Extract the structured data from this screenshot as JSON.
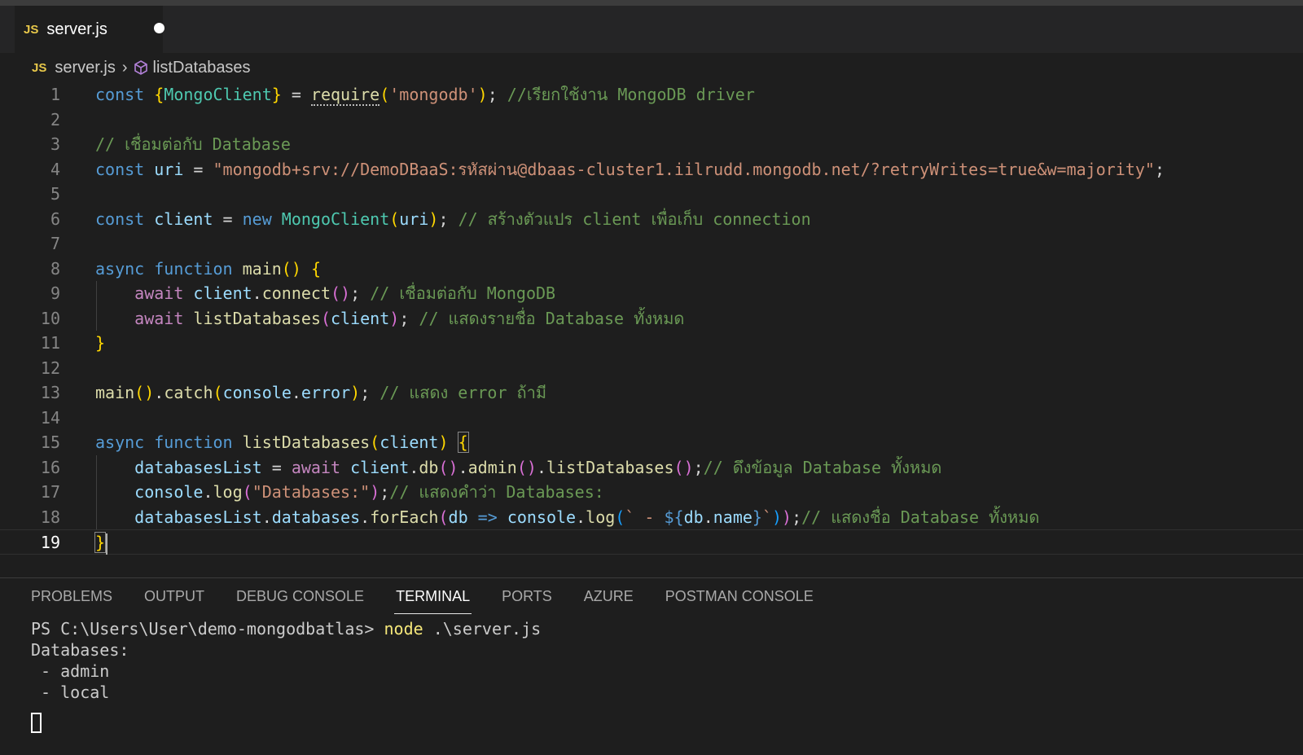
{
  "tab": {
    "icon": "JS",
    "filename": "server.js",
    "dirty": true
  },
  "breadcrumb": {
    "file_icon": "JS",
    "file": "server.js",
    "symbol_icon": "cube-icon",
    "symbol": "listDatabases"
  },
  "editor": {
    "current_line": 19,
    "line_numbers": [
      "1",
      "2",
      "3",
      "4",
      "5",
      "6",
      "7",
      "8",
      "9",
      "10",
      "11",
      "12",
      "13",
      "14",
      "15",
      "16",
      "17",
      "18",
      "19"
    ],
    "lines": [
      [
        [
          "kw",
          "const "
        ],
        [
          "br1",
          "{"
        ],
        [
          "cls",
          "MongoClient"
        ],
        [
          "br1",
          "}"
        ],
        [
          "pun",
          " = "
        ],
        [
          "fn",
          "require"
        ],
        [
          "br1",
          "("
        ],
        [
          "str",
          "'mongodb'"
        ],
        [
          "br1",
          ")"
        ],
        [
          "pun",
          "; "
        ],
        [
          "cmt",
          "//เรียกใช้งาน MongoDB driver"
        ]
      ],
      [],
      [
        [
          "cmt",
          "// เชื่อมต่อกับ Database"
        ]
      ],
      [
        [
          "kw",
          "const "
        ],
        [
          "var",
          "uri"
        ],
        [
          "pun",
          " = "
        ],
        [
          "str",
          "\"mongodb+srv://DemoDBaaS:รหัสผ่าน@dbaas-cluster1.iilrudd.mongodb.net/?retryWrites=true&w=majority\""
        ],
        [
          "pun",
          ";"
        ]
      ],
      [],
      [
        [
          "kw",
          "const "
        ],
        [
          "var",
          "client"
        ],
        [
          "pun",
          " = "
        ],
        [
          "kw",
          "new "
        ],
        [
          "cls",
          "MongoClient"
        ],
        [
          "br1",
          "("
        ],
        [
          "var",
          "uri"
        ],
        [
          "br1",
          ")"
        ],
        [
          "pun",
          "; "
        ],
        [
          "cmt",
          "// สร้างตัวแปร client เพื่อเก็บ connection"
        ]
      ],
      [],
      [
        [
          "kw",
          "async "
        ],
        [
          "kw",
          "function "
        ],
        [
          "fn",
          "main"
        ],
        [
          "br1",
          "()"
        ],
        [
          "pun",
          " "
        ],
        [
          "br1",
          "{"
        ]
      ],
      [
        [
          "pun",
          "    "
        ],
        [
          "ctl",
          "await "
        ],
        [
          "var",
          "client"
        ],
        [
          "pun",
          "."
        ],
        [
          "fn",
          "connect"
        ],
        [
          "br2",
          "()"
        ],
        [
          "pun",
          "; "
        ],
        [
          "cmt",
          "// เชื่อมต่อกับ MongoDB"
        ]
      ],
      [
        [
          "pun",
          "    "
        ],
        [
          "ctl",
          "await "
        ],
        [
          "fn",
          "listDatabases"
        ],
        [
          "br2",
          "("
        ],
        [
          "var",
          "client"
        ],
        [
          "br2",
          ")"
        ],
        [
          "pun",
          "; "
        ],
        [
          "cmt",
          "// แสดงรายชื่อ Database ทั้งหมด"
        ]
      ],
      [
        [
          "br1",
          "}"
        ]
      ],
      [],
      [
        [
          "fn",
          "main"
        ],
        [
          "br1",
          "()"
        ],
        [
          "pun",
          "."
        ],
        [
          "fn",
          "catch"
        ],
        [
          "br1",
          "("
        ],
        [
          "var",
          "console"
        ],
        [
          "pun",
          "."
        ],
        [
          "var",
          "error"
        ],
        [
          "br1",
          ")"
        ],
        [
          "pun",
          "; "
        ],
        [
          "cmt",
          "// แสดง error ถ้ามี"
        ]
      ],
      [],
      [
        [
          "kw",
          "async "
        ],
        [
          "kw",
          "function "
        ],
        [
          "fn",
          "listDatabases"
        ],
        [
          "br1",
          "("
        ],
        [
          "var",
          "client"
        ],
        [
          "br1",
          ")"
        ],
        [
          "pun",
          " "
        ],
        [
          "br1",
          "{"
        ]
      ],
      [
        [
          "pun",
          "    "
        ],
        [
          "var",
          "databasesList"
        ],
        [
          "pun",
          " = "
        ],
        [
          "ctl",
          "await "
        ],
        [
          "var",
          "client"
        ],
        [
          "pun",
          "."
        ],
        [
          "fn",
          "db"
        ],
        [
          "br2",
          "()"
        ],
        [
          "pun",
          "."
        ],
        [
          "fn",
          "admin"
        ],
        [
          "br2",
          "()"
        ],
        [
          "pun",
          "."
        ],
        [
          "fn",
          "listDatabases"
        ],
        [
          "br2",
          "()"
        ],
        [
          "pun",
          ";"
        ],
        [
          "cmt",
          "// ดึงข้อมูล Database ทั้งหมด"
        ]
      ],
      [
        [
          "pun",
          "    "
        ],
        [
          "var",
          "console"
        ],
        [
          "pun",
          "."
        ],
        [
          "fn",
          "log"
        ],
        [
          "br2",
          "("
        ],
        [
          "str",
          "\"Databases:\""
        ],
        [
          "br2",
          ")"
        ],
        [
          "pun",
          ";"
        ],
        [
          "cmt",
          "// แสดงคำว่า Databases:"
        ]
      ],
      [
        [
          "pun",
          "    "
        ],
        [
          "var",
          "databasesList"
        ],
        [
          "pun",
          "."
        ],
        [
          "var",
          "databases"
        ],
        [
          "pun",
          "."
        ],
        [
          "fn",
          "forEach"
        ],
        [
          "br2",
          "("
        ],
        [
          "var",
          "db"
        ],
        [
          "pun",
          " "
        ],
        [
          "kw",
          "=>"
        ],
        [
          "pun",
          " "
        ],
        [
          "var",
          "console"
        ],
        [
          "pun",
          "."
        ],
        [
          "fn",
          "log"
        ],
        [
          "br3",
          "("
        ],
        [
          "str",
          "` - "
        ],
        [
          "kw",
          "${"
        ],
        [
          "var",
          "db"
        ],
        [
          "pun",
          "."
        ],
        [
          "var",
          "name"
        ],
        [
          "kw",
          "}"
        ],
        [
          "str",
          "`"
        ],
        [
          "br3",
          ")"
        ],
        [
          "br2",
          ")"
        ],
        [
          "pun",
          ";"
        ],
        [
          "cmt",
          "// แสดงชื่อ Database ทั้งหมด"
        ]
      ],
      [
        [
          "br1",
          "}"
        ]
      ]
    ]
  },
  "panel": {
    "tabs": [
      "PROBLEMS",
      "OUTPUT",
      "DEBUG CONSOLE",
      "TERMINAL",
      "PORTS",
      "AZURE",
      "POSTMAN CONSOLE"
    ],
    "active_tab": "TERMINAL",
    "terminal": {
      "prompt": "PS C:\\Users\\User\\demo-mongodbatlas> ",
      "command": "node",
      "args": " .\\server.js",
      "output": [
        "Databases:",
        " - admin",
        " - local"
      ]
    }
  },
  "colors": {
    "editor_bg": "#1e1e1e",
    "keyword": "#569cd6",
    "string": "#ce9178",
    "comment": "#6a9955",
    "function": "#dcdcaa",
    "class": "#4ec9b0",
    "variable": "#9cdcfe"
  }
}
